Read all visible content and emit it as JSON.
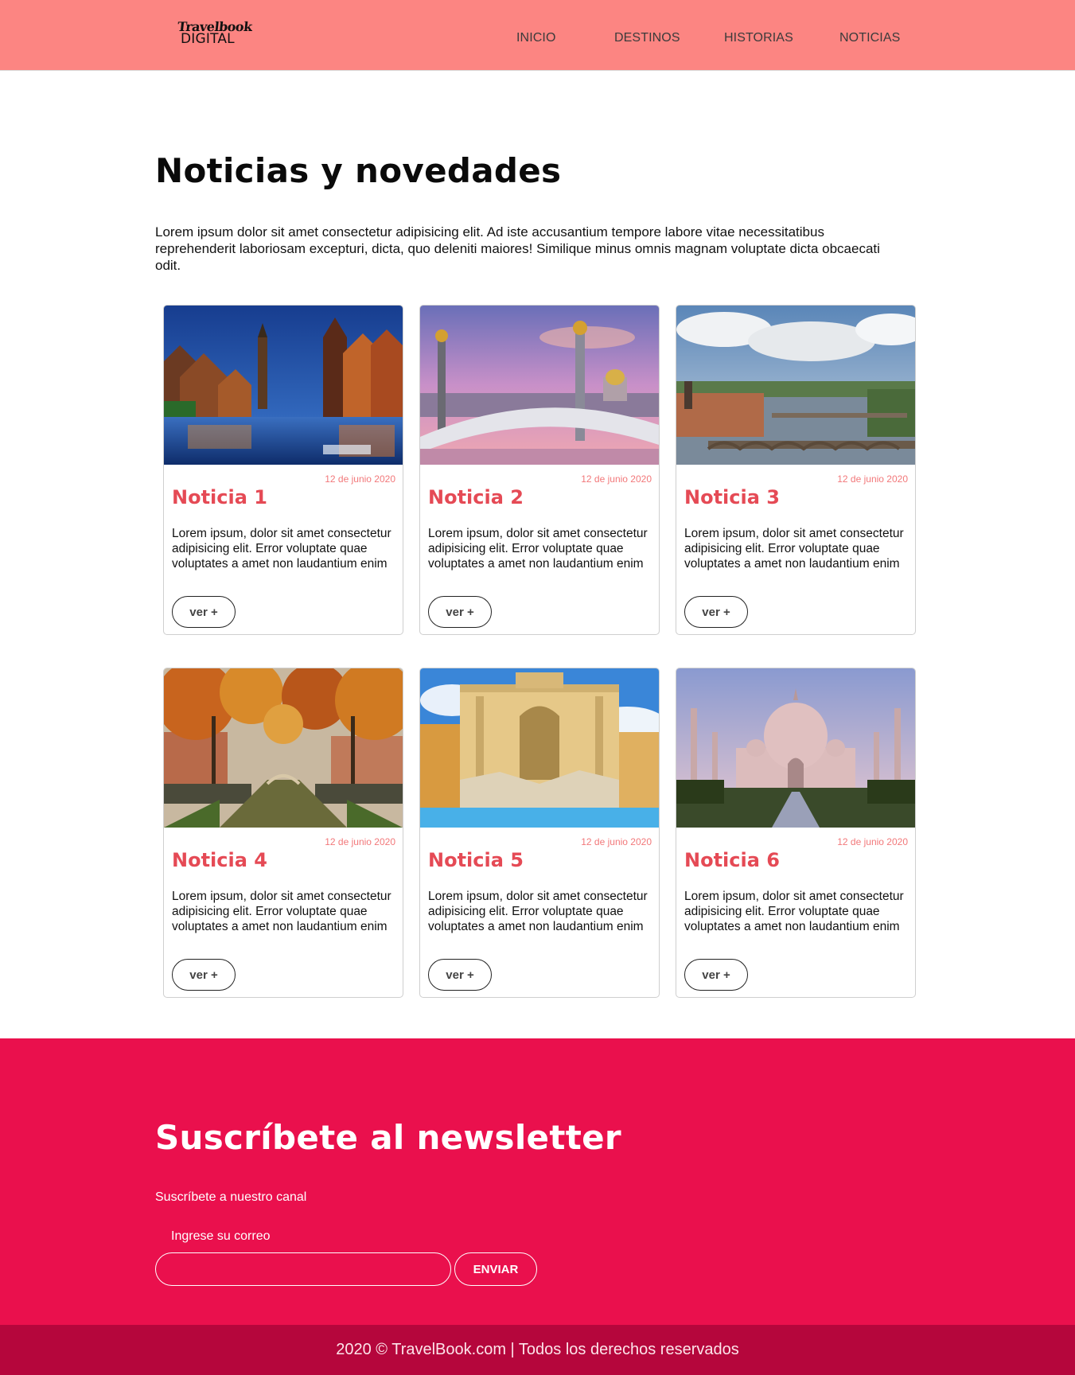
{
  "header": {
    "logo": {
      "line1": "Travelbook",
      "line2": "DIGITAL"
    },
    "nav": [
      {
        "label": "INICIO"
      },
      {
        "label": "DESTINOS"
      },
      {
        "label": "HISTORIAS"
      },
      {
        "label": "NOTICIAS"
      }
    ]
  },
  "main": {
    "title": "Noticias y novedades",
    "intro": "Lorem ipsum dolor sit amet consectetur adipisicing elit. Ad iste accusantium tempore labore vitae necessitatibus reprehenderit laboriosam excepturi, dicta, quo deleniti maiores! Similique minus omnis magnam voluptate dicta obcaecati odit."
  },
  "cards": [
    {
      "date": "12 de junio 2020",
      "title": "Noticia 1",
      "text": "Lorem ipsum, dolor sit amet consectetur adipisicing elit. Error voluptate quae voluptates a amet non laudantium enim",
      "button": "ver +"
    },
    {
      "date": "12 de junio 2020",
      "title": "Noticia 2",
      "text": "Lorem ipsum, dolor sit amet consectetur adipisicing elit. Error voluptate quae voluptates a amet non laudantium enim",
      "button": "ver +"
    },
    {
      "date": "12 de junio 2020",
      "title": "Noticia 3",
      "text": "Lorem ipsum, dolor sit amet consectetur adipisicing elit. Error voluptate quae voluptates a amet non laudantium enim",
      "button": "ver +"
    },
    {
      "date": "12 de junio 2020",
      "title": "Noticia 4",
      "text": "Lorem ipsum, dolor sit amet consectetur adipisicing elit. Error voluptate quae voluptates a amet non laudantium enim",
      "button": "ver +"
    },
    {
      "date": "12 de junio 2020",
      "title": "Noticia 5",
      "text": "Lorem ipsum, dolor sit amet consectetur adipisicing elit. Error voluptate quae voluptates a amet non laudantium enim",
      "button": "ver +"
    },
    {
      "date": "12 de junio 2020",
      "title": "Noticia 6",
      "text": "Lorem ipsum, dolor sit amet consectetur adipisicing elit. Error voluptate quae voluptates a amet non laudantium enim",
      "button": "ver +"
    }
  ],
  "newsletter": {
    "title": "Suscríbete al newsletter",
    "subtitle": "Suscríbete a nuestro canal",
    "email_label": "Ingrese su correo",
    "email_value": "",
    "submit_label": "ENVIAR"
  },
  "footer": {
    "copyright": "2020 © TravelBook.com | Todos los derechos reservados"
  },
  "colors": {
    "header_bg": "#fc8582",
    "card_title": "#e54a55",
    "card_date": "#f2787a",
    "newsletter_bg": "#ea104d",
    "footer_bg": "#b5063c"
  }
}
